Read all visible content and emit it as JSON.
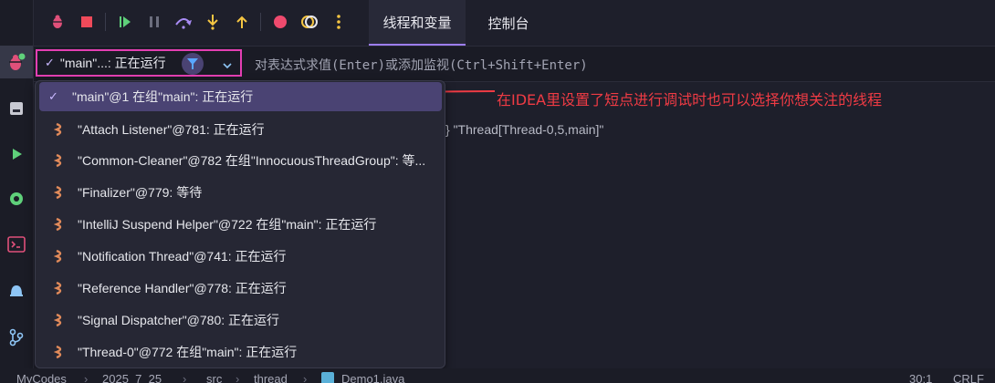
{
  "sidebar": {
    "icons": [
      {
        "name": "debug-icon",
        "active": true
      },
      {
        "name": "database-icon",
        "active": false
      },
      {
        "name": "run-icon",
        "active": false
      },
      {
        "name": "settings-icon",
        "active": false
      },
      {
        "name": "terminal-icon",
        "active": false
      },
      {
        "name": "problems-icon",
        "active": false
      },
      {
        "name": "git-icon",
        "active": false
      }
    ]
  },
  "toolbar": {
    "buttons": [
      "rerun-debug-icon",
      "stop-icon",
      "resume-icon",
      "pause-icon",
      "step-over-icon",
      "step-into-icon",
      "step-out-icon",
      "view-breakpoints-icon",
      "mute-breakpoints-icon",
      "more-icon"
    ]
  },
  "tabs": [
    {
      "label": "线程和变量",
      "active": true
    },
    {
      "label": "控制台",
      "active": false
    }
  ],
  "thread_selector": {
    "label": "\"main\"...: 正在运行"
  },
  "eval": {
    "placeholder": "对表达式求值(Enter)或添加监视(Ctrl+Shift+Enter)"
  },
  "background_text": "} \"Thread[Thread-0,5,main]\"",
  "annotation": "在IDEA里设置了短点进行调试时也可以选择你想关注的线程",
  "threads": [
    {
      "label": "\"main\"@1 在组\"main\": 正在运行",
      "selected": true
    },
    {
      "label": "\"Attach Listener\"@781: 正在运行",
      "selected": false
    },
    {
      "label": "\"Common-Cleaner\"@782 在组\"InnocuousThreadGroup\": 等...",
      "selected": false
    },
    {
      "label": "\"Finalizer\"@779: 等待",
      "selected": false
    },
    {
      "label": "\"IntelliJ Suspend Helper\"@722 在组\"main\": 正在运行",
      "selected": false
    },
    {
      "label": "\"Notification Thread\"@741: 正在运行",
      "selected": false
    },
    {
      "label": "\"Reference Handler\"@778: 正在运行",
      "selected": false
    },
    {
      "label": "\"Signal Dispatcher\"@780: 正在运行",
      "selected": false
    },
    {
      "label": "\"Thread-0\"@772 在组\"main\": 正在运行",
      "selected": false
    }
  ],
  "status_bar": {
    "breadcrumbs": [
      "MyCodes",
      "2025_7_25",
      "src",
      "thread",
      "Demo1.java"
    ],
    "position": "30:1",
    "line_ending": "CRLF"
  },
  "colors": {
    "accent": "#9d7ef0",
    "highlight_border": "#e43fb3",
    "annotation": "#ef3b44",
    "selected_row": "#4a4373"
  }
}
